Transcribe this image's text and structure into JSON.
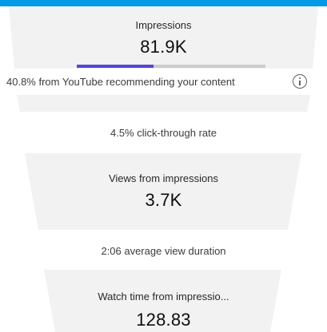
{
  "colors": {
    "accent_bar": "#039be5",
    "progress_fill": "#5546d4",
    "progress_track": "#cccccc",
    "stage_fill": "#f2f2f2",
    "gap_fill": "#ffffff"
  },
  "impressions": {
    "title": "Impressions",
    "value": "81.9K",
    "recommendation_share": 0.408,
    "recommendation_note": "40.8% from YouTube recommending your content",
    "info_icon": "info-icon"
  },
  "click_through": {
    "label": "4.5% click-through rate"
  },
  "views": {
    "title": "Views from impressions",
    "value": "3.7K"
  },
  "avg_duration": {
    "label": "2:06 average view duration"
  },
  "watch_time": {
    "title": "Watch time from impressio...",
    "value": "128.83"
  }
}
